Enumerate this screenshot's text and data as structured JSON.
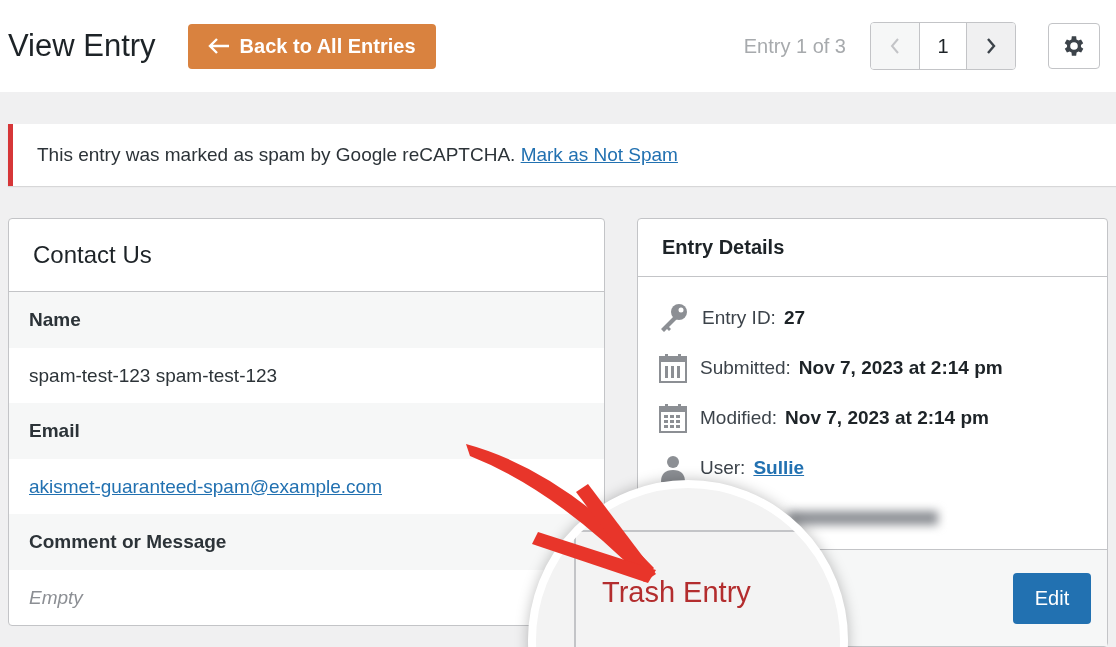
{
  "header": {
    "title": "View Entry",
    "back_button": "Back to All Entries",
    "entry_count": "Entry 1 of 3",
    "pager": {
      "prev_disabled": true,
      "page": "1",
      "next_disabled": false
    }
  },
  "notice": {
    "text": "This entry was marked as spam by Google reCAPTCHA.",
    "link": "Mark as Not Spam"
  },
  "form_panel": {
    "title": "Contact Us",
    "fields": [
      {
        "label": "Name",
        "value": "spam-test-123 spam-test-123",
        "kind": "text"
      },
      {
        "label": "Email",
        "value": "akismet-guaranteed-spam@example.com",
        "kind": "link"
      },
      {
        "label": "Comment or Message",
        "value": "Empty",
        "kind": "empty"
      }
    ]
  },
  "details_panel": {
    "title": "Entry Details",
    "items": [
      {
        "kind": "key",
        "label": "Entry ID:",
        "value": "27"
      },
      {
        "kind": "calendar",
        "label": "Submitted:",
        "value": "Nov 7, 2023 at 2:14 pm"
      },
      {
        "kind": "calendar-grid",
        "label": "Modified:",
        "value": "Nov 7, 2023 at 2:14 pm"
      },
      {
        "kind": "user",
        "label": "User:",
        "value": "Sullie"
      }
    ],
    "trash_link": "Trash Entry",
    "edit_button": "Edit"
  }
}
